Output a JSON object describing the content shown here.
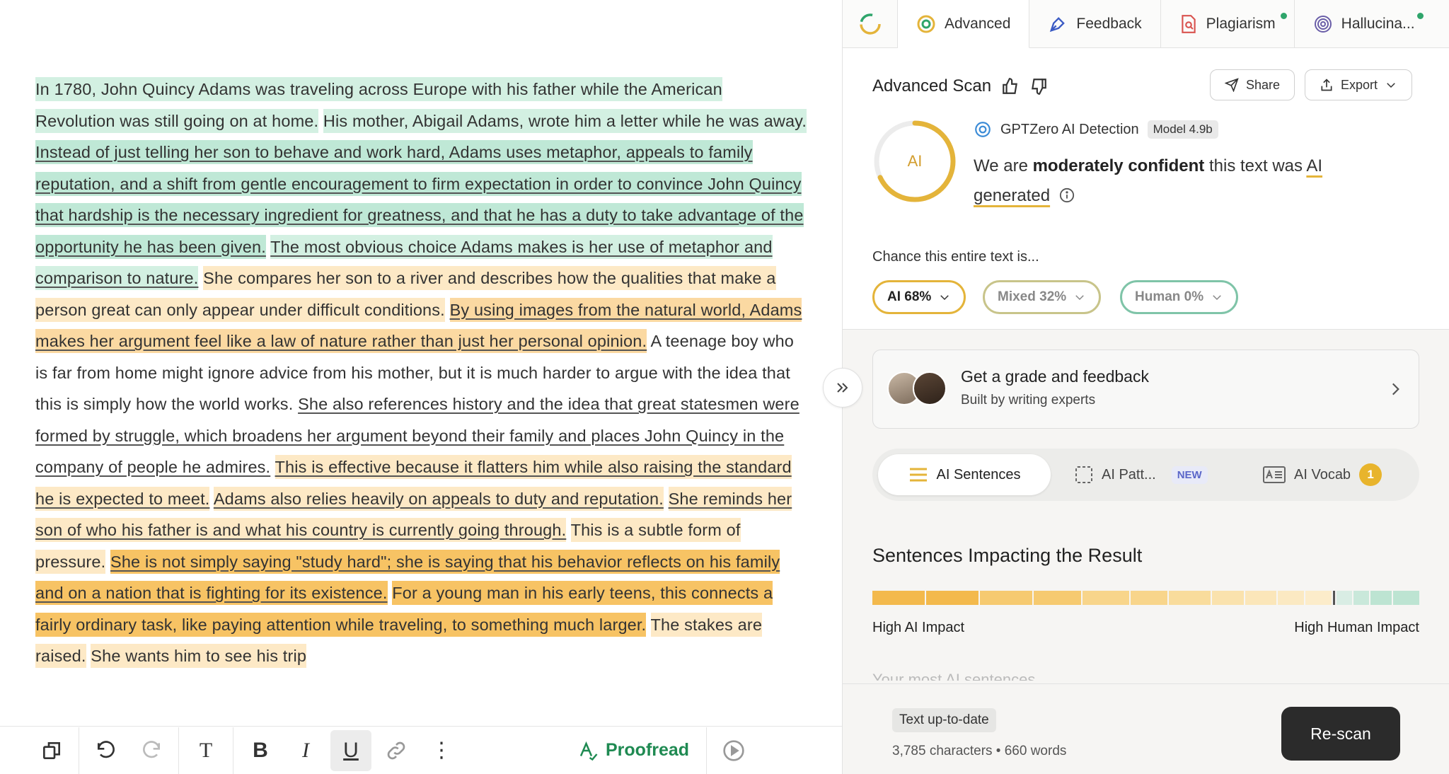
{
  "editor": {
    "sentences": [
      {
        "id": "s1",
        "text": "In 1780, John Quincy Adams was traveling across Europe with his father while the American Revolution was still going on at home.",
        "hl": "h1"
      },
      {
        "id": "s2",
        "text": "His mother, Abigail Adams, wrote him a letter while he was away.",
        "hl": "h1"
      },
      {
        "id": "s3",
        "text": "Instead of just telling her son to behave and work hard, Adams uses metaphor, appeals to family reputation, and a shift from gentle encouragement to firm expectation in order to convince John Quincy that hardship is the necessary ingredient for greatness, and that he has a duty to take advantage of the opportunity he has been given.",
        "hl": "h2"
      },
      {
        "id": "s4",
        "text": "The most obvious choice Adams makes is her use of metaphor and comparison to nature.",
        "hl": "h1"
      },
      {
        "id": "s5",
        "text": "She compares her son to a river and describes how the qualities that make a person great can only appear under difficult conditions.",
        "hl": "o1"
      },
      {
        "id": "s6",
        "text": "By using images from the natural world, Adams makes her argument feel like a law of nature rather than just her personal opinion.",
        "hl": "o2"
      },
      {
        "id": "s7",
        "text": "A teenage boy who is far from home might ignore advice from his mother, but it is much harder to argue with the idea that this is simply how the world works.",
        "hl": ""
      },
      {
        "id": "s8",
        "text": "She also references history and the idea that great statesmen were formed by struggle, which broadens her argument beyond their family and places John Quincy in the company of people he admires.",
        "hl": ""
      },
      {
        "id": "s9",
        "text": "This is effective because it flatters him while also raising the standard he is expected to meet.",
        "hl": "o1"
      },
      {
        "id": "s10",
        "text": "Adams also relies heavily on appeals to duty and reputation.",
        "hl": "o1"
      },
      {
        "id": "s11",
        "text": "She reminds her son of who his father is and what his country is currently going through.",
        "hl": "o1"
      },
      {
        "id": "s12",
        "text": "This is a subtle form of pressure.",
        "hl": "o1"
      },
      {
        "id": "s13",
        "text": "She is not simply saying \"study hard\"; she is saying that his behavior reflects on his family and on a nation that is fighting for its existence.",
        "hl": "o3"
      },
      {
        "id": "s14",
        "text": "For a young man in his early teens, this connects a fairly ordinary task, like paying attention while traveling, to something much larger.",
        "hl": "o3"
      },
      {
        "id": "s15",
        "text": "The stakes are raised.",
        "hl": "o1"
      },
      {
        "id": "s16",
        "text": "She wants him to see his trip",
        "hl": "o1"
      }
    ],
    "proofread_label": "Proofread"
  },
  "tabs": [
    {
      "label": "Advanced",
      "active": true
    },
    {
      "label": "Feedback"
    },
    {
      "label": "Plagiarism",
      "dot": true
    },
    {
      "label": "Hallucina...",
      "dot": true
    }
  ],
  "scan": {
    "title": "Advanced Scan",
    "share_label": "Share",
    "export_label": "Export",
    "ring_label": "AI",
    "ai_fraction": 0.68,
    "detector_label": "GPTZero AI Detection",
    "model_label": "Model 4.9b",
    "verdict_pre": "We are ",
    "verdict_bold": "moderately confident",
    "verdict_mid": " this text was ",
    "verdict_ai": "AI generated",
    "chance_label": "Chance this entire text is...",
    "pills": [
      {
        "label": "AI 68%",
        "color": "#e4b43a",
        "text": "#222"
      },
      {
        "label": "Mixed 32%",
        "color": "#c8c48a",
        "text": "#888"
      },
      {
        "label": "Human 0%",
        "color": "#7fc4a8",
        "text": "#888"
      }
    ]
  },
  "grade": {
    "title": "Get a grade and feedback",
    "subtitle": "Built by writing experts"
  },
  "segments": {
    "sentences_label": "AI Sentences",
    "patterns_label": "AI Patt...",
    "new_label": "NEW",
    "vocab_label": "AI Vocab",
    "vocab_count": "1"
  },
  "impact": {
    "title": "Sentences Impacting the Result",
    "left_label": "High AI Impact",
    "right_label": "High Human Impact",
    "cut_label": "Your most AI sentences",
    "bar_colors": [
      "#f3b94c",
      "#f3b94c",
      "#f6ca70",
      "#f6ca70",
      "#f8d58b",
      "#f8d58b",
      "#f9dc9c",
      "#fae2ad",
      "#fbe6b9",
      "#fbe9c2",
      "#fcecca",
      "#d9ede4",
      "#c9e8da",
      "#bde4d2",
      "#bde4d2"
    ]
  },
  "footer": {
    "status": "Text up-to-date",
    "counts": "3,785 characters • 660 words",
    "rescan_label": "Re-scan"
  },
  "colors": {
    "accent": "#e4b43a",
    "green": "#1f8a52",
    "human": "#7fc4a8"
  }
}
